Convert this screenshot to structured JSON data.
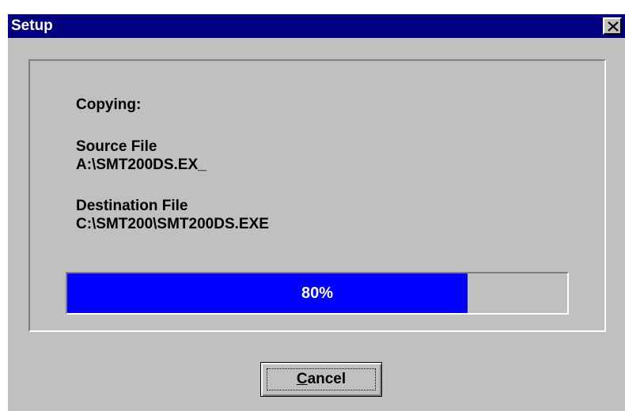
{
  "window": {
    "title": "Setup",
    "close_icon": "close-icon"
  },
  "copy": {
    "heading": "Copying:",
    "source_label": "Source File",
    "source_path": "A:\\SMT200DS.EX_",
    "destination_label": "Destination File",
    "destination_path": "C:\\SMT200\\SMT200DS.EXE"
  },
  "progress": {
    "value": 0.8,
    "label": "80%",
    "fill_color": "#0000ff"
  },
  "cancel_button": {
    "mnemonic": "C",
    "rest": "ancel"
  },
  "colors": {
    "titlebar": "#000080",
    "face": "#c0c0c0"
  }
}
